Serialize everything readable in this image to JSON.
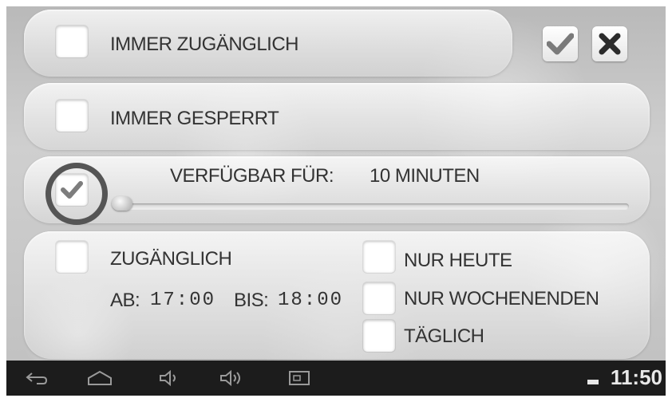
{
  "options": {
    "always_accessible": {
      "label": "IMMER ZUGÄNGLICH",
      "checked": false
    },
    "always_blocked": {
      "label": "IMMER GESPERRT",
      "checked": false
    },
    "available_for": {
      "label": "VERFÜGBAR FÜR:",
      "value": "10 MINUTEN",
      "checked": true,
      "slider_fraction": 0.0
    },
    "accessible": {
      "label": "ZUGÄNGLICH",
      "checked": false,
      "from_label": "AB:",
      "from_time": "17:00",
      "to_label": "BIS:",
      "to_time": "18:00",
      "only_today": "NUR HEUTE",
      "only_weekends": "NUR WOCHENENDEN",
      "daily": "TÄGLICH"
    }
  },
  "actions": {
    "confirm_icon": "check-icon",
    "cancel_icon": "close-icon"
  },
  "navbar": {
    "icons": [
      "back-icon",
      "home-icon",
      "volume-down-icon",
      "volume-up-icon",
      "screenshot-icon"
    ],
    "time": "11:50"
  },
  "colors": {
    "ring": "#555555",
    "navbar": "#1c1c1c",
    "text": "#333333"
  }
}
